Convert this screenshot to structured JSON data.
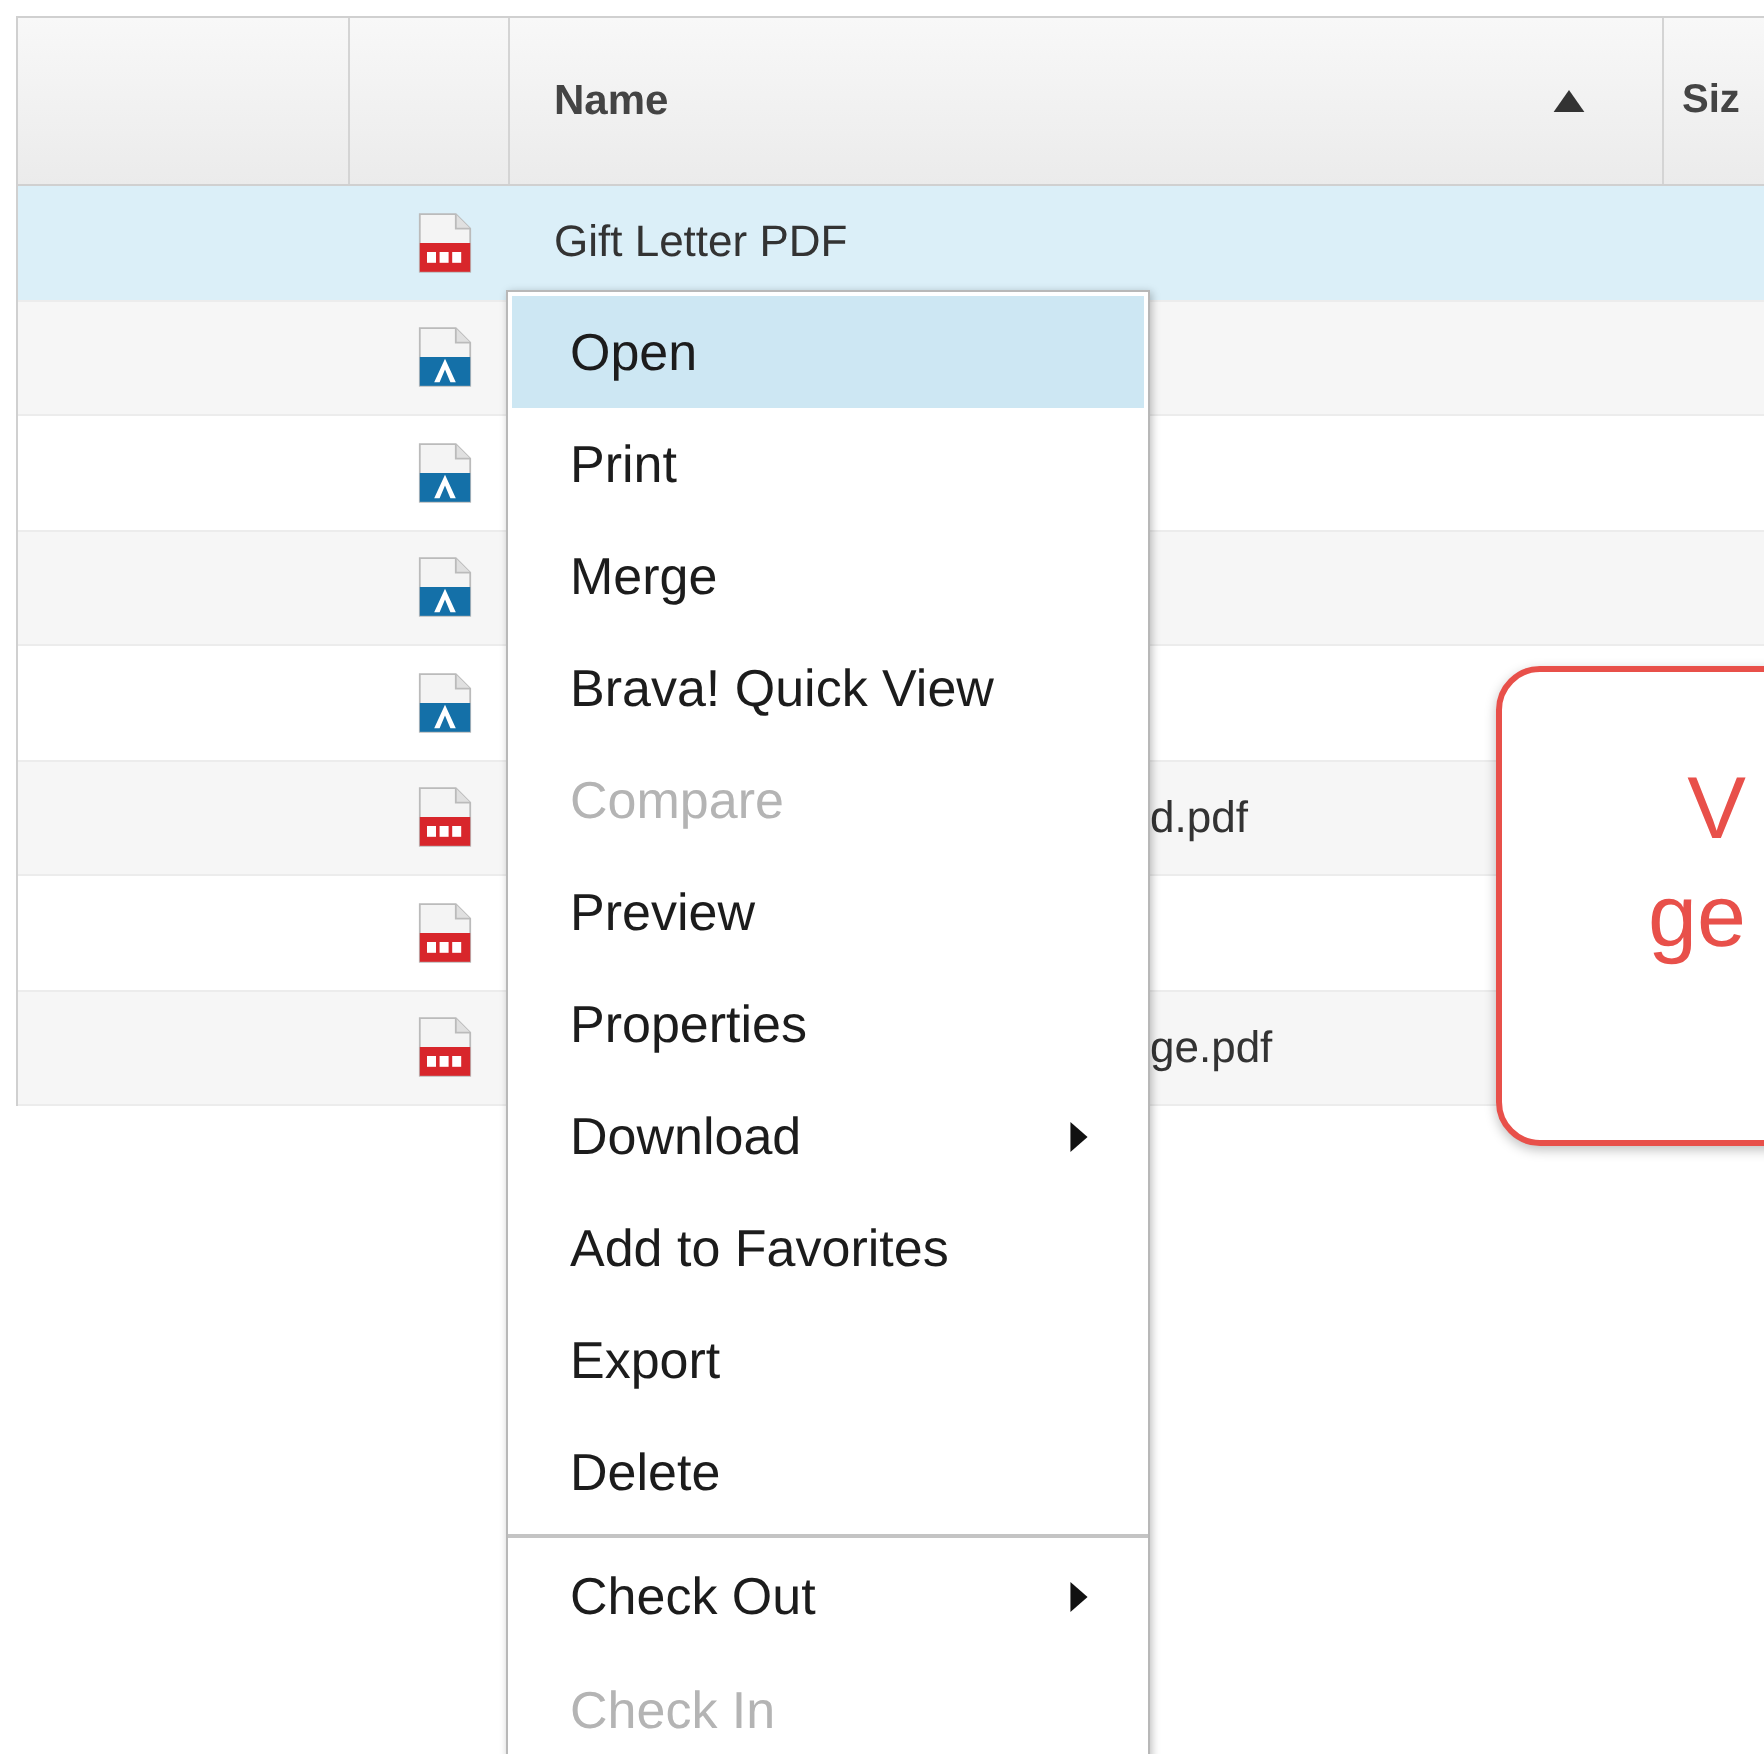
{
  "table": {
    "columns": [
      {
        "sorted": false
      },
      {
        "sorted": false
      },
      {
        "label": "Name",
        "sorted": true
      },
      {
        "label": "Siz"
      }
    ],
    "rows": [
      {
        "kind": "pdf",
        "name": "Gift Letter PDF",
        "selected": true
      },
      {
        "kind": "document",
        "selected": false
      },
      {
        "kind": "document",
        "selected": false
      },
      {
        "kind": "document",
        "selected": false
      },
      {
        "kind": "document",
        "selected": false
      },
      {
        "kind": "pdf",
        "name": "d.pdf",
        "selected": false
      },
      {
        "kind": "pdf",
        "selected": false
      },
      {
        "kind": "pdf",
        "name": "ge.pdf",
        "selected": false
      }
    ]
  },
  "context_menu": {
    "items": [
      {
        "label": "Open",
        "selected": true,
        "disabled": false,
        "submenu": false,
        "separator_before": false
      },
      {
        "label": "Print",
        "selected": false,
        "disabled": false,
        "submenu": false,
        "separator_before": false
      },
      {
        "label": "Merge",
        "selected": false,
        "disabled": false,
        "submenu": false,
        "separator_before": false
      },
      {
        "label": "Brava! Quick View",
        "selected": false,
        "disabled": false,
        "submenu": false,
        "separator_before": false
      },
      {
        "label": "Compare",
        "selected": false,
        "disabled": true,
        "submenu": false,
        "separator_before": false
      },
      {
        "label": "Preview",
        "selected": false,
        "disabled": false,
        "submenu": false,
        "separator_before": false
      },
      {
        "label": "Properties",
        "selected": false,
        "disabled": false,
        "submenu": false,
        "separator_before": false
      },
      {
        "label": "Download",
        "selected": false,
        "disabled": false,
        "submenu": true,
        "separator_before": false
      },
      {
        "label": "Add to Favorites",
        "selected": false,
        "disabled": false,
        "submenu": false,
        "separator_before": false
      },
      {
        "label": "Export",
        "selected": false,
        "disabled": false,
        "submenu": false,
        "separator_before": false
      },
      {
        "label": "Delete",
        "selected": false,
        "disabled": false,
        "submenu": false,
        "separator_before": false
      },
      {
        "label": "Check Out",
        "selected": false,
        "disabled": false,
        "submenu": true,
        "separator_before": true
      },
      {
        "label": "Check In",
        "selected": false,
        "disabled": true,
        "submenu": false,
        "separator_before": false
      }
    ]
  },
  "callout": {
    "lines": [
      "V",
      "ge"
    ]
  }
}
